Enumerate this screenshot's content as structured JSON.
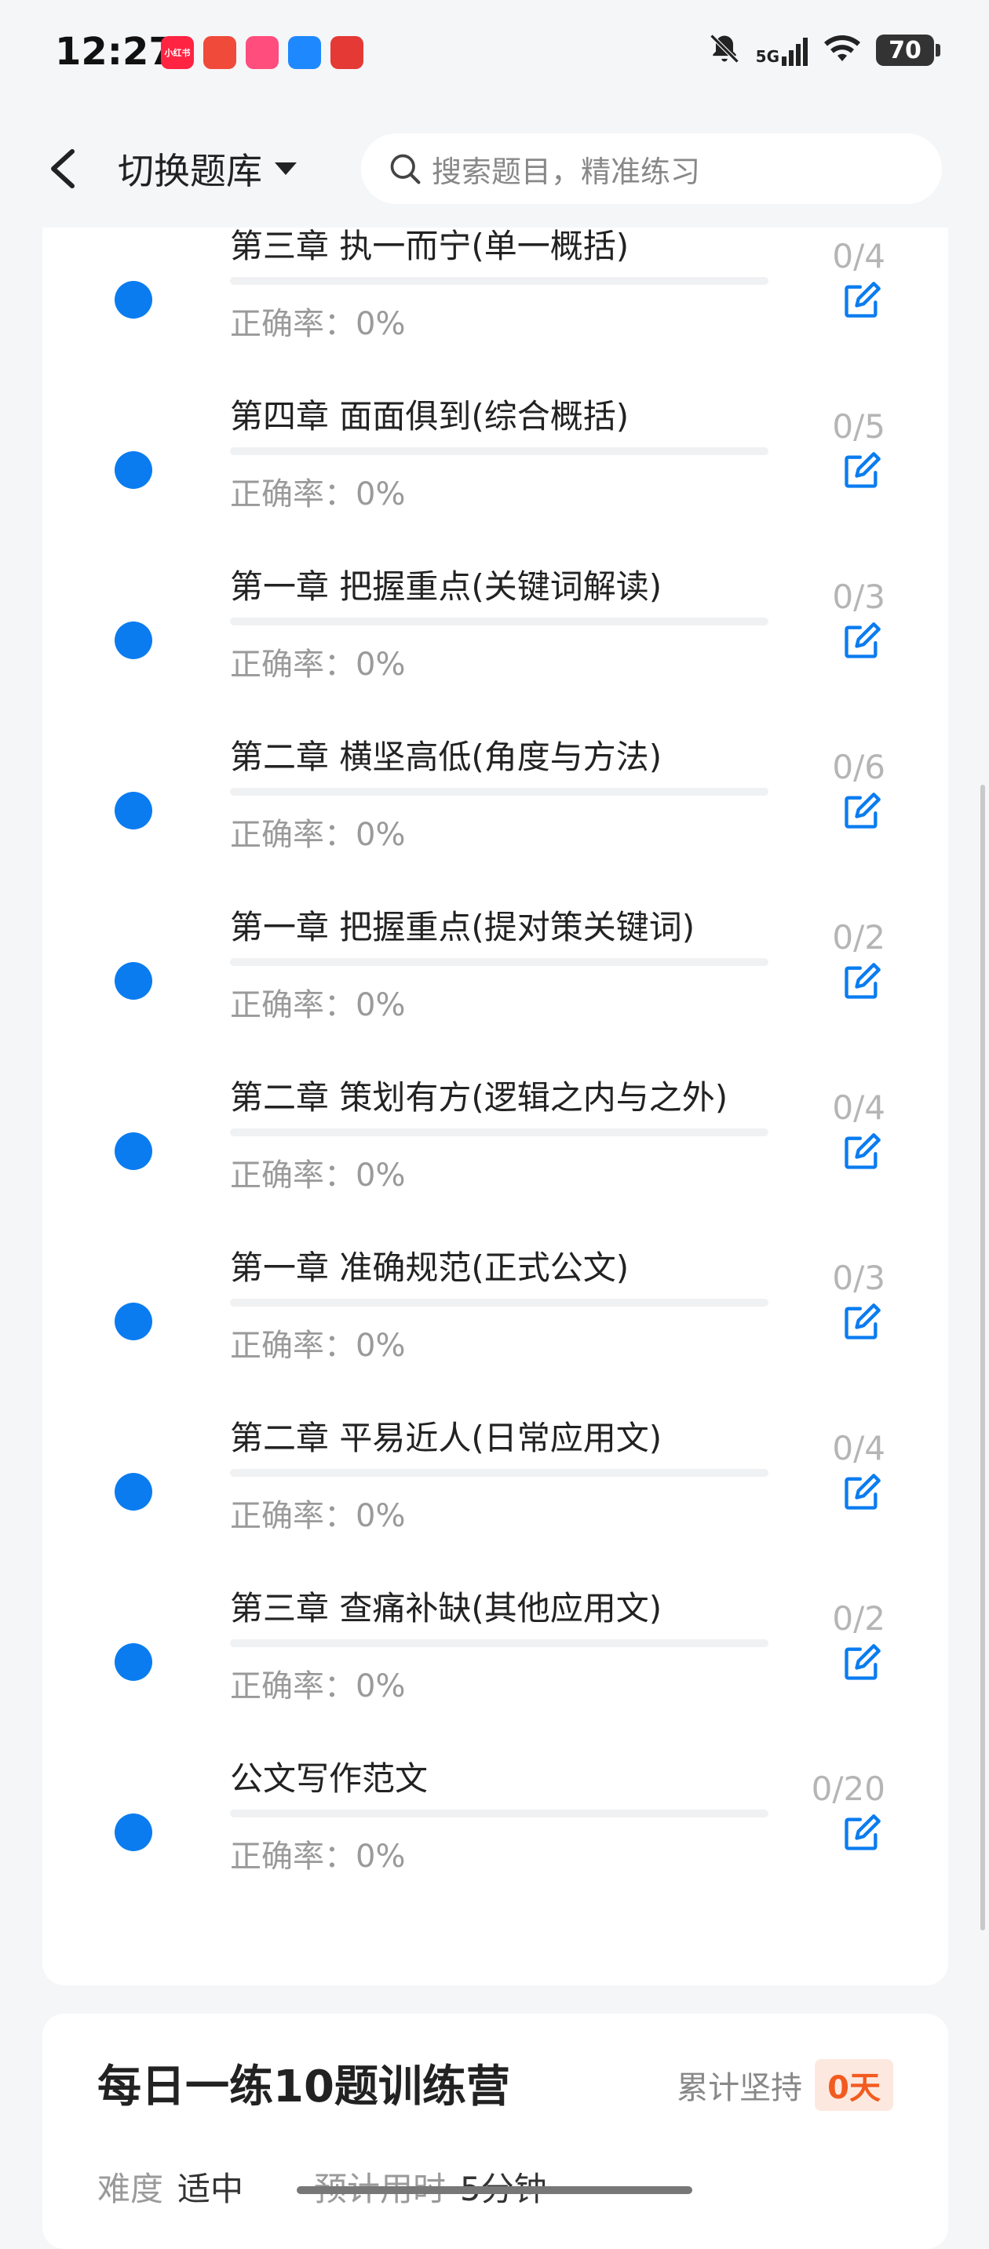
{
  "status_bar": {
    "time": "12:27",
    "app_icons": [
      {
        "name": "xiaohongshu-icon",
        "label": "小红书",
        "color": "#ff2442"
      },
      {
        "name": "boat-app-icon",
        "label": "",
        "color": "#f04a3a"
      },
      {
        "name": "pink-app-icon",
        "label": "",
        "color": "#ff4d7d"
      },
      {
        "name": "shield-app-icon",
        "label": "",
        "color": "#1e88ff"
      },
      {
        "name": "pinduoduo-icon",
        "label": "",
        "color": "#e53935"
      }
    ],
    "network": "5G",
    "battery": "70"
  },
  "header": {
    "switch_label": "切换题库",
    "search_placeholder": "搜索题目，精准练习"
  },
  "chapters": [
    {
      "title": "第三章 执一而宁(单一概括)",
      "accuracy": "正确率：0%",
      "count": "0/4",
      "progress": 0
    },
    {
      "title": "第四章 面面俱到(综合概括)",
      "accuracy": "正确率：0%",
      "count": "0/5",
      "progress": 0
    },
    {
      "title": "第一章 把握重点(关键词解读)",
      "accuracy": "正确率：0%",
      "count": "0/3",
      "progress": 0
    },
    {
      "title": "第二章 横坚高低(角度与方法)",
      "accuracy": "正确率：0%",
      "count": "0/6",
      "progress": 0
    },
    {
      "title": "第一章 把握重点(提对策关键词)",
      "accuracy": "正确率：0%",
      "count": "0/2",
      "progress": 0
    },
    {
      "title": "第二章 策划有方(逻辑之内与之外)",
      "accuracy": "正确率：0%",
      "count": "0/4",
      "progress": 0
    },
    {
      "title": "第一章 准确规范(正式公文)",
      "accuracy": "正确率：0%",
      "count": "0/3",
      "progress": 0
    },
    {
      "title": "第二章 平易近人(日常应用文)",
      "accuracy": "正确率：0%",
      "count": "0/4",
      "progress": 0
    },
    {
      "title": "第三章 查痛补缺(其他应用文)",
      "accuracy": "正确率：0%",
      "count": "0/2",
      "progress": 0
    },
    {
      "title": "公文写作范文",
      "accuracy": "正确率：0%",
      "count": "0/20",
      "progress": 0
    }
  ],
  "camp": {
    "title": "每日一练10题训练营",
    "persist_label": "累计坚持",
    "persist_value": "0天",
    "difficulty_label": "难度",
    "difficulty_value": "适中",
    "time_label": "预计用时",
    "time_value": "5分钟"
  },
  "colors": {
    "accent": "#0a7cf0",
    "badge_text": "#f25b1f",
    "badge_bg": "#fde8df"
  }
}
